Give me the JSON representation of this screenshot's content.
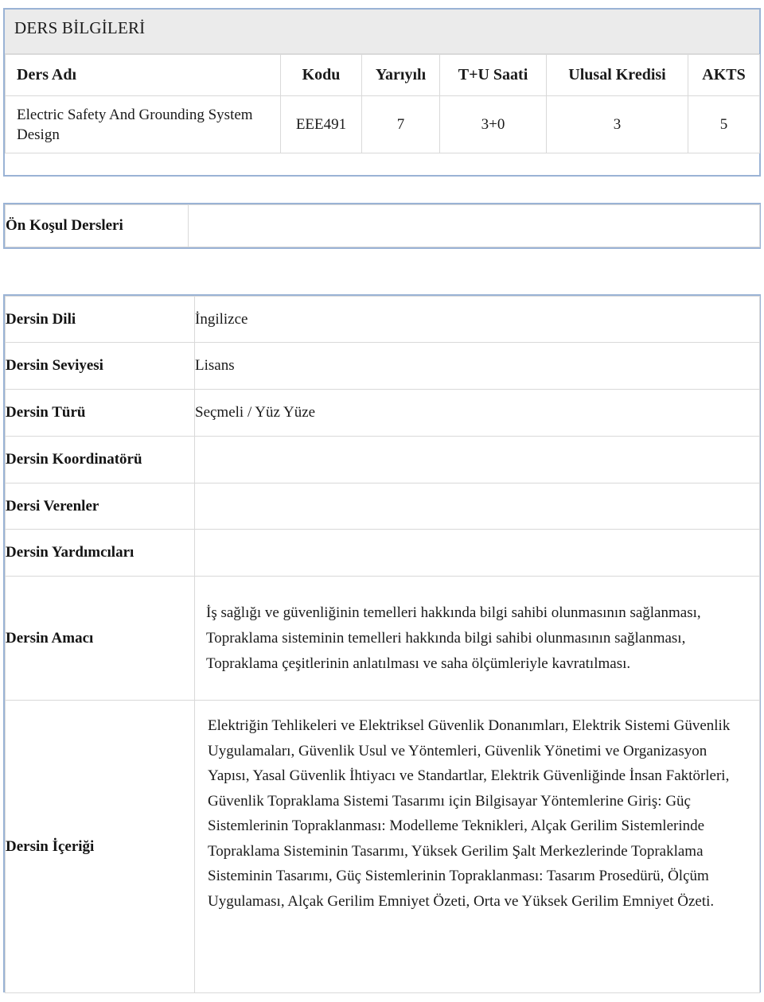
{
  "section": {
    "title": "DERS BİLGİLERİ"
  },
  "course_table": {
    "headers": [
      "Ders Adı",
      "Kodu",
      "Yarıyılı",
      "T+U Saati",
      "Ulusal Kredisi",
      "AKTS"
    ],
    "rows": [
      {
        "ders_adi": "Electric Safety And Grounding System Design",
        "kodu": "EEE491",
        "yariyili": "7",
        "tu_saati": "3+0",
        "ulusal_kredisi": "3",
        "akts": "5"
      }
    ]
  },
  "prerequisite": {
    "label": "Ön Koşul Dersleri",
    "value": ""
  },
  "details": {
    "rows": [
      {
        "label": "Dersin Dili",
        "value": "İngilizce"
      },
      {
        "label": "Dersin Seviyesi",
        "value": "Lisans"
      },
      {
        "label": "Dersin Türü",
        "value": "Seçmeli / Yüz Yüze"
      },
      {
        "label": "Dersin Koordinatörü",
        "value": ""
      },
      {
        "label": "Dersi Verenler",
        "value": ""
      },
      {
        "label": "Dersin Yardımcıları",
        "value": ""
      }
    ],
    "amac": {
      "label": "Dersin Amacı",
      "value": "İş sağlığı ve güvenliğinin temelleri hakkında bilgi sahibi olunmasının sağlanması, Topraklama sisteminin temelleri hakkında bilgi sahibi olunmasının sağlanması, Topraklama çeşitlerinin anlatılması ve saha ölçümleriyle kavratılması."
    },
    "icerik": {
      "label": "Dersin İçeriği",
      "value": " Elektriğin Tehlikeleri ve Elektriksel Güvenlik Donanımları, Elektrik Sistemi Güvenlik Uygulamaları, Güvenlik Usul ve Yöntemleri, Güvenlik Yönetimi ve Organizasyon Yapısı, Yasal Güvenlik İhtiyacı ve Standartlar, Elektrik Güvenliğinde İnsan Faktörleri, Güvenlik Topraklama Sistemi Tasarımı için Bilgisayar Yöntemlerine Giriş: Güç Sistemlerinin Topraklanması: Modelleme Teknikleri, Alçak Gerilim Sistemlerinde Topraklama Sisteminin Tasarımı, Yüksek Gerilim Şalt Merkezlerinde Topraklama Sisteminin Tasarımı, Güç Sistemlerinin Topraklanması: Tasarım Prosedürü, Ölçüm Uygulaması, Alçak Gerilim Emniyet Özeti, Orta ve Yüksek Gerilim Emniyet Özeti."
    }
  },
  "colors": {
    "frame_border": "#9ab3d5",
    "cell_border": "#d9d9d9",
    "title_background": "#ebebeb",
    "text": "#1a1a1a"
  }
}
